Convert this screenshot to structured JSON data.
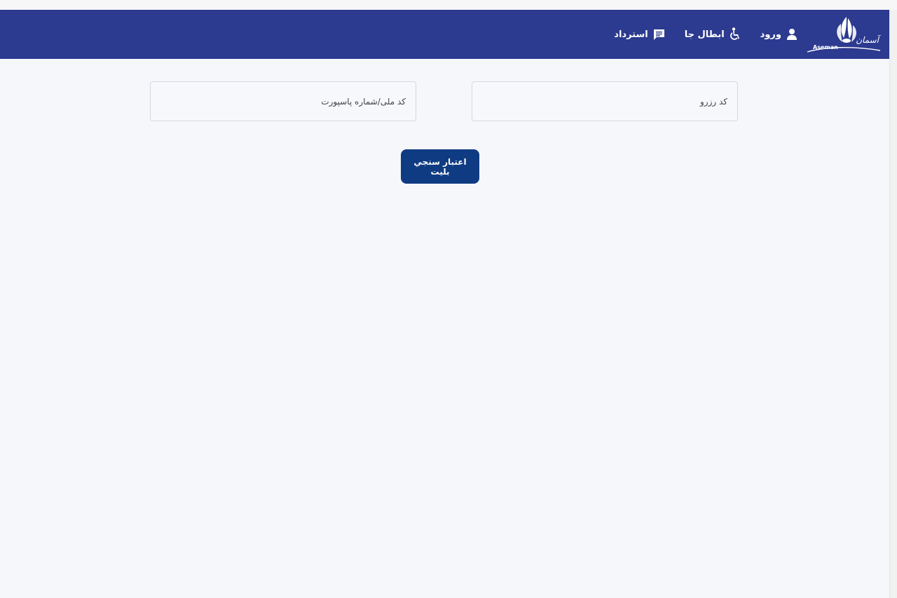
{
  "header": {
    "logo": {
      "brand_fa": "آسمان",
      "brand_en": "Aseman",
      "icon": "aseman-wing-logo"
    },
    "nav": [
      {
        "label": "ورود",
        "icon": "user-icon"
      },
      {
        "label": "ابطال جا",
        "icon": "wheelchair-icon"
      },
      {
        "label": "استرداد",
        "icon": "message-icon"
      }
    ],
    "background_color": "#2c3a8f"
  },
  "form": {
    "reserve_code": {
      "placeholder": "کد رزرو",
      "value": ""
    },
    "national_code": {
      "placeholder": "کد ملی/شماره پاسپورت",
      "value": ""
    },
    "submit_label": "اعتبار سنجي بليت"
  },
  "colors": {
    "primary_button": "#0f3b82",
    "page_background": "#f6f7fa"
  }
}
